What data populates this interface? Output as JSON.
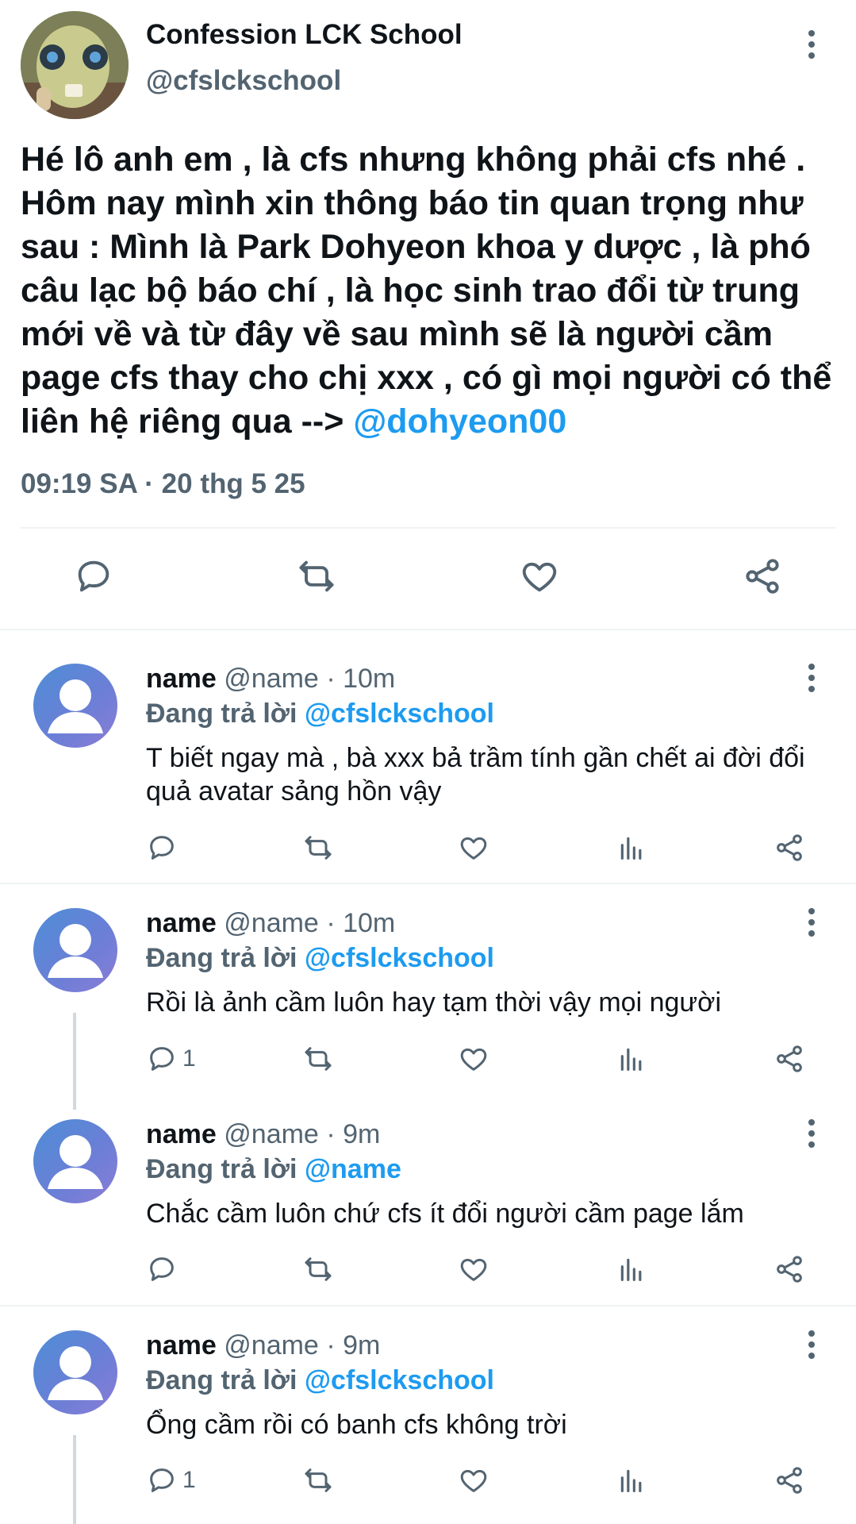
{
  "tweet": {
    "author_name": "Confession LCK School",
    "author_handle": "@cfslckschool",
    "body_text": "Hé lô anh em , là cfs nhưng không phải cfs nhé . Hôm nay mình xin thông báo tin quan trọng như sau : Mình là Park Dohyeon khoa y dược , là phó câu lạc bộ báo chí , là học sinh trao đổi từ trung mới về và từ đây về sau mình sẽ là người cầm page cfs thay cho chị xxx , có gì mọi người có thể liên hệ riêng qua --> ",
    "body_mention": "@dohyeon00",
    "timestamp": "09:19 SA · 20 thg 5 25",
    "actions": [
      "reply-icon",
      "retweet-icon",
      "like-icon",
      "share-icon"
    ]
  },
  "replies": [
    {
      "name": "name",
      "handle": "@name",
      "time": "· 10m",
      "replying_prefix": "Đang trả lời ",
      "replying_to": "@cfslckschool",
      "text": "T biết ngay mà , bà xxx bả trầm tính gần chết ai đời đổi quả avatar sảng hồn vậy",
      "reply_count": ""
    },
    {
      "name": "name",
      "handle": "@name",
      "time": "· 10m",
      "replying_prefix": "Đang trả lời ",
      "replying_to": "@cfslckschool",
      "text": "Rồi là ảnh cầm luôn hay tạm thời vậy mọi người",
      "reply_count": "1"
    },
    {
      "name": "name",
      "handle": "@name",
      "time": "· 9m",
      "replying_prefix": "Đang trả lời ",
      "replying_to": "@name",
      "text": "Chắc cầm luôn chứ cfs ít đổi người cầm page lắm",
      "reply_count": ""
    },
    {
      "name": "name",
      "handle": "@name",
      "time": "· 9m",
      "replying_prefix": "Đang trả lời ",
      "replying_to": "@cfslckschool",
      "text": "Ổng cầm rồi có banh cfs không trời",
      "reply_count": "1"
    }
  ],
  "colors": {
    "accent": "#1d9bf0",
    "muted": "#536471",
    "text": "#0f1419",
    "divider": "#eff3f4"
  }
}
